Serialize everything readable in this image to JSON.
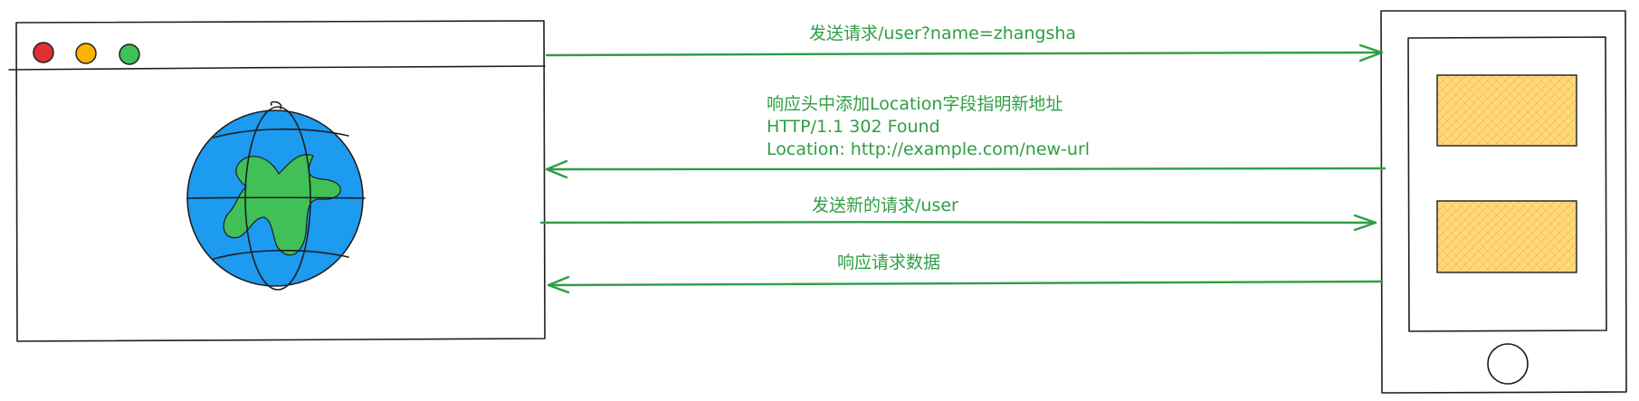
{
  "browser": {
    "traffic_lights": [
      "#e03131",
      "#f8b400",
      "#40c057"
    ],
    "globe_colors": {
      "water": "#1c9bf0",
      "land": "#40c057"
    }
  },
  "server": {
    "body_color": "#ced4da",
    "panel_color": "#ffd97a"
  },
  "arrow_color": "#2f9e44",
  "messages": {
    "request": "发送请求/user?name=zhangsha",
    "redirect": {
      "line1": "响应头中添加Location字段指明新地址",
      "line2": "HTTP/1.1 302 Found",
      "line3": "Location: http://example.com/new-url"
    },
    "new_request": "发送新的请求/user",
    "response": "响应请求数据"
  }
}
